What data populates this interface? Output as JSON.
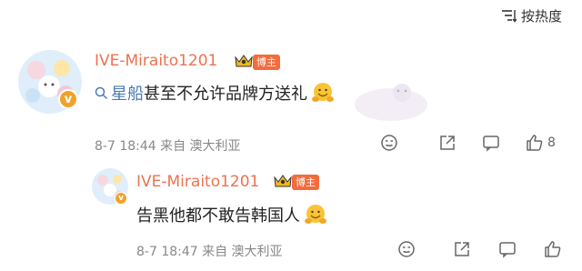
{
  "header": {
    "sort_label": "按热度"
  },
  "comments": [
    {
      "username": "IVE-Miraito1201",
      "tag": "博主",
      "topic": "星船",
      "text": "甚至不允许品牌方送礼",
      "meta": "8-7 18:44  来自 澳大利亚",
      "like_count": "8"
    },
    {
      "username": "IVE-Miraito1201",
      "tag": "博主",
      "text": "告黑他都不敢告韩国人",
      "meta": "8-7 18:47  来自 澳大利亚"
    }
  ],
  "colors": {
    "username": "#eb7350",
    "topic_link": "#4a7bb7",
    "tag": "#f46b3c",
    "verified": "#f2a22a"
  }
}
